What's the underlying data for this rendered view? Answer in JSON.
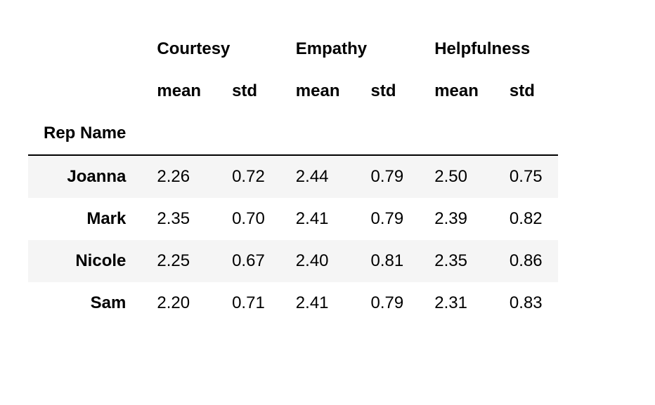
{
  "chart_data": {
    "type": "table",
    "title": "",
    "index_label": "Rep Name",
    "metrics": [
      "Courtesy",
      "Empathy",
      "Helpfulness"
    ],
    "stats": [
      "mean",
      "std"
    ],
    "rows": [
      {
        "name": "Joanna",
        "Courtesy": {
          "mean": "2.26",
          "std": "0.72"
        },
        "Empathy": {
          "mean": "2.44",
          "std": "0.79"
        },
        "Helpfulness": {
          "mean": "2.50",
          "std": "0.75"
        }
      },
      {
        "name": "Mark",
        "Courtesy": {
          "mean": "2.35",
          "std": "0.70"
        },
        "Empathy": {
          "mean": "2.41",
          "std": "0.79"
        },
        "Helpfulness": {
          "mean": "2.39",
          "std": "0.82"
        }
      },
      {
        "name": "Nicole",
        "Courtesy": {
          "mean": "2.25",
          "std": "0.67"
        },
        "Empathy": {
          "mean": "2.40",
          "std": "0.81"
        },
        "Helpfulness": {
          "mean": "2.35",
          "std": "0.86"
        }
      },
      {
        "name": "Sam",
        "Courtesy": {
          "mean": "2.20",
          "std": "0.71"
        },
        "Empathy": {
          "mean": "2.41",
          "std": "0.79"
        },
        "Helpfulness": {
          "mean": "2.31",
          "std": "0.83"
        }
      }
    ]
  }
}
